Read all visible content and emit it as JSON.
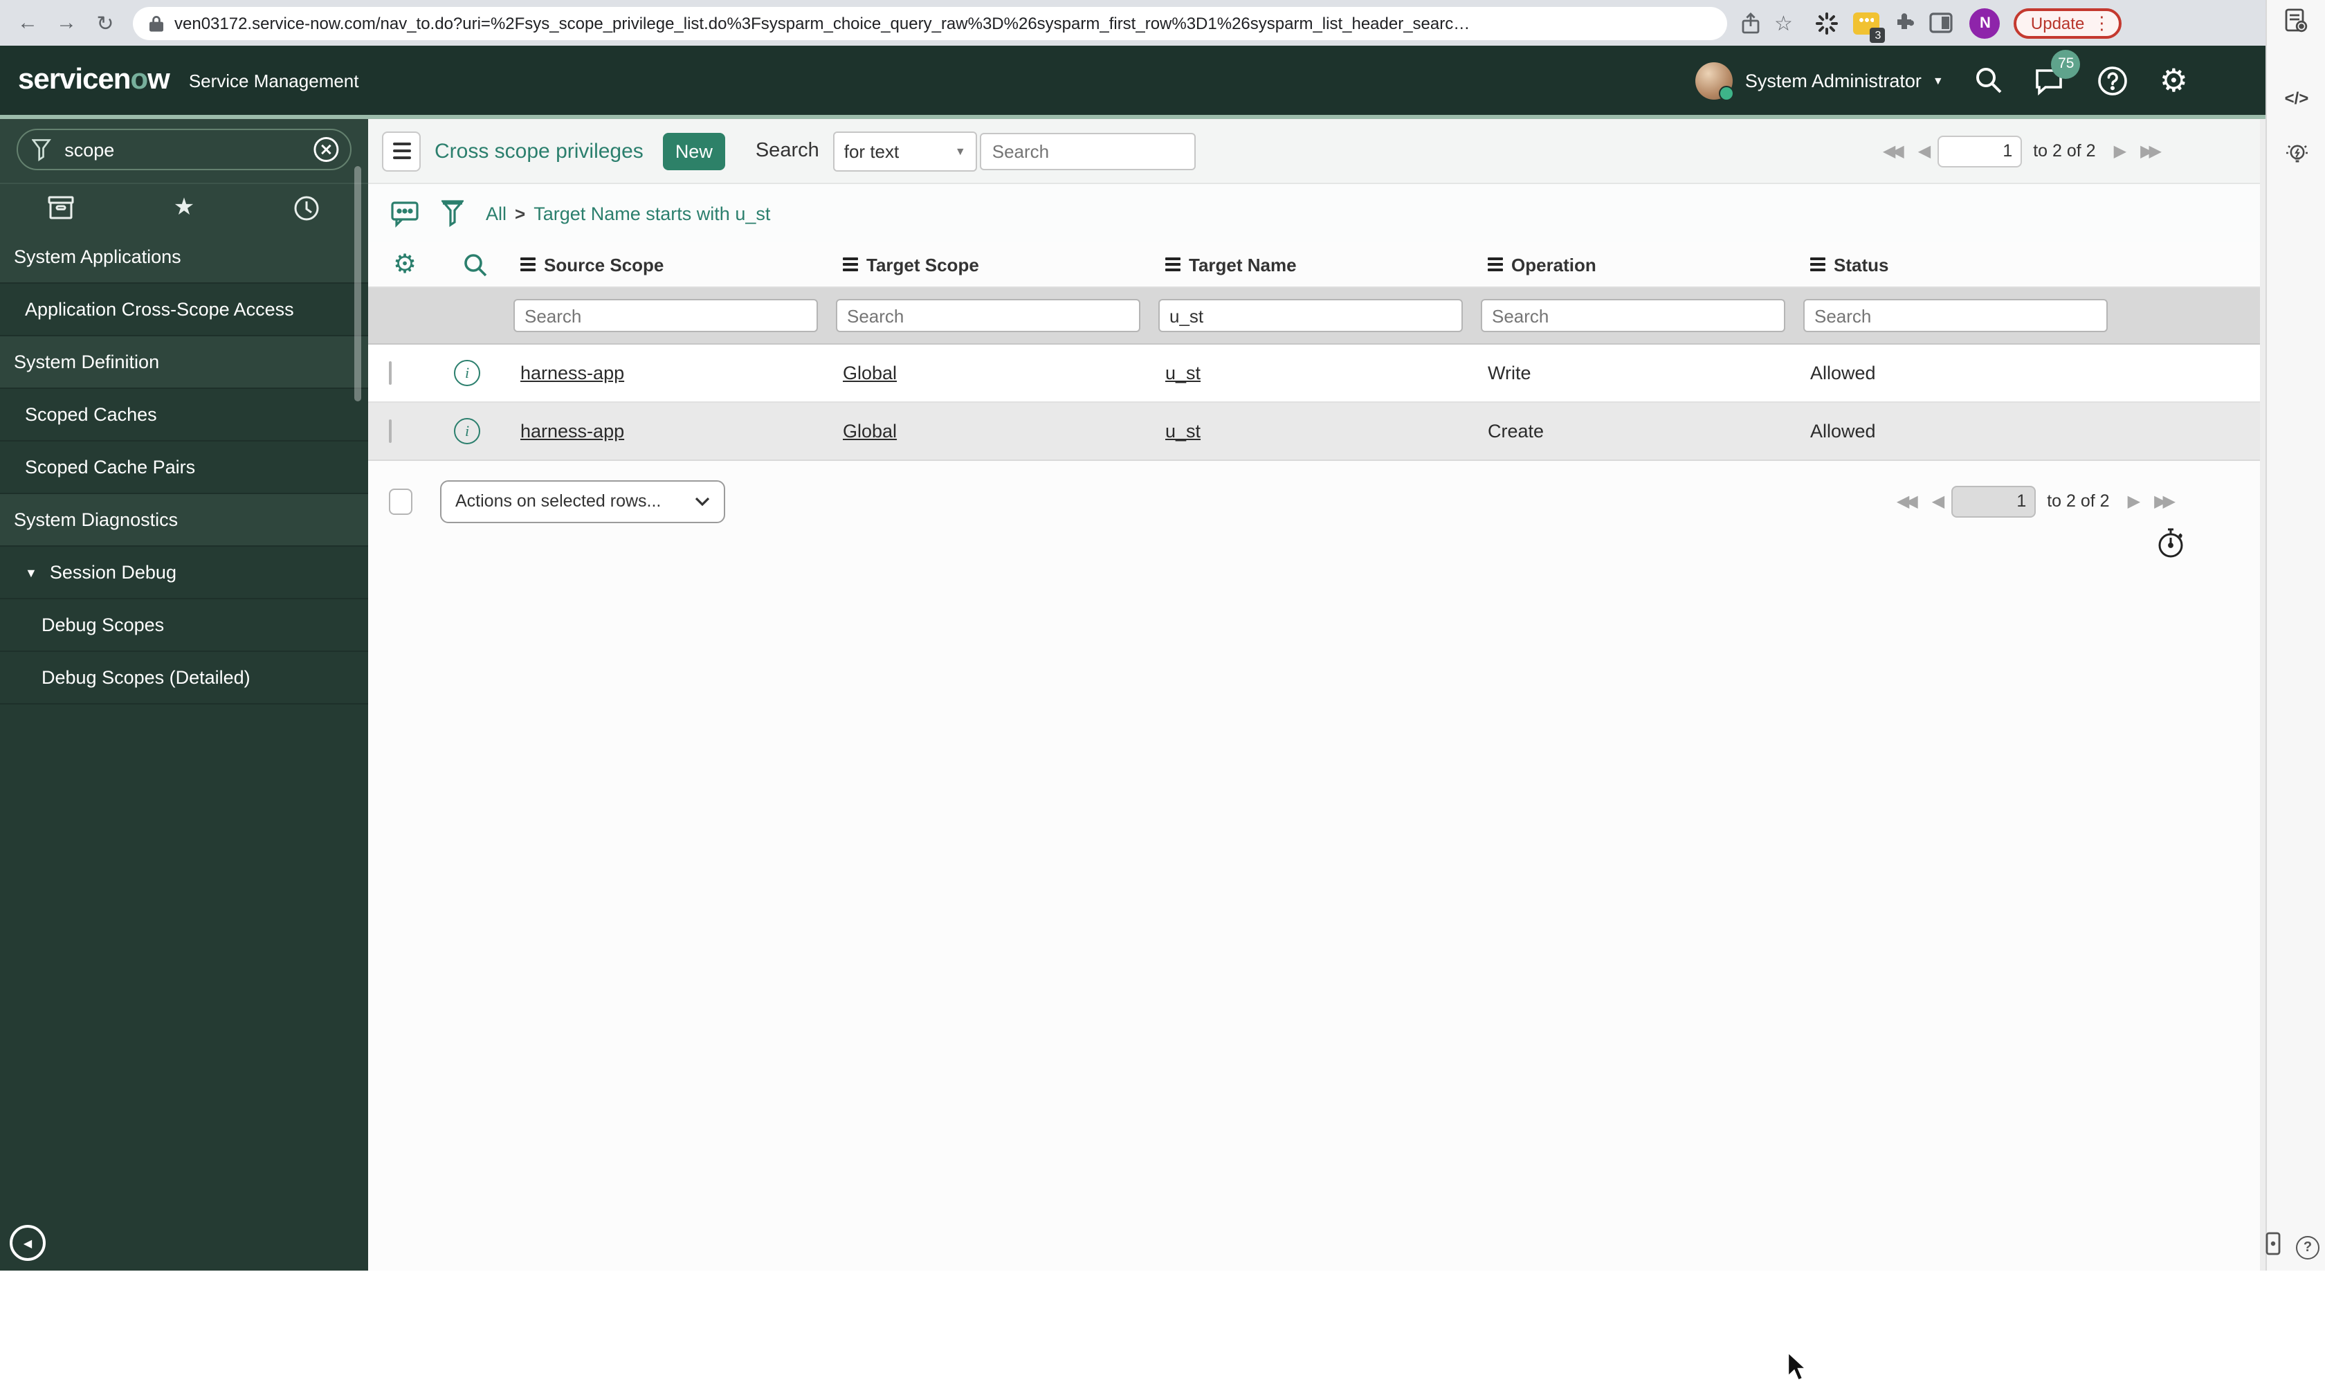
{
  "browser": {
    "url": "ven03172.service-now.com/nav_to.do?uri=%2Fsys_scope_privilege_list.do%3Fsysparm_choice_query_raw%3D%26sysparm_first_row%3D1%26sysparm_list_header_searc…",
    "update_label": "Update",
    "extension_badge": "3",
    "profile_initial": "N"
  },
  "icons": {
    "back": "←",
    "forward": "→",
    "reload": "↻",
    "bookmark_star": "☆",
    "dots_vertical": "⋮",
    "user_caret": "▼",
    "select_caret": "▼",
    "gear": "⚙",
    "help": "?",
    "code_panel": "</>",
    "pager_first": "◀◀",
    "pager_prev": "◀",
    "pager_next": "▶",
    "pager_last": "▶▶",
    "favorites_star": "★",
    "expand_caret": "▼",
    "collapse_back": "◀",
    "info": "i"
  },
  "header": {
    "logo_pre": "servicen",
    "logo_o": "o",
    "logo_post": "w",
    "product": "Service Management",
    "user_name": "System Administrator",
    "notifications_count": "75"
  },
  "sidebar": {
    "search_value": "scope",
    "items": [
      {
        "label": "System Applications",
        "type": "header"
      },
      {
        "label": "Application Cross-Scope Access",
        "type": "item"
      },
      {
        "label": "System Definition",
        "type": "header"
      },
      {
        "label": "Scoped Caches",
        "type": "item"
      },
      {
        "label": "Scoped Cache Pairs",
        "type": "item"
      },
      {
        "label": "System Diagnostics",
        "type": "header"
      },
      {
        "label": "Session Debug",
        "type": "expandable"
      },
      {
        "label": "Debug Scopes",
        "type": "subitem"
      },
      {
        "label": "Debug Scopes (Detailed)",
        "type": "subitem"
      }
    ]
  },
  "toolbar": {
    "title": "Cross scope privileges",
    "new_label": "New",
    "search_label": "Search",
    "search_mode": "for text",
    "search_placeholder": "Search"
  },
  "breadcrumb": {
    "root": "All",
    "separator": ">",
    "filter": "Target Name starts with u_st"
  },
  "table": {
    "columns": [
      "Source Scope",
      "Target Scope",
      "Target Name",
      "Operation",
      "Status"
    ],
    "filter_placeholder": "Search",
    "target_name_filter": "u_st",
    "rows": [
      {
        "source_scope": "harness-app",
        "target_scope": "Global",
        "target_name": "u_st",
        "operation": "Write",
        "status": "Allowed"
      },
      {
        "source_scope": "harness-app",
        "target_scope": "Global",
        "target_name": "u_st",
        "operation": "Create",
        "status": "Allowed"
      }
    ]
  },
  "pagination": {
    "page": "1",
    "range_label": "to 2 of 2"
  },
  "actions_bar": {
    "dropdown_label": "Actions on selected rows..."
  },
  "colors": {
    "accent": "#2d8168",
    "header_bg": "#1d332c",
    "sidebar_bg": "#253b33",
    "sidebar_row_alt": "#2f463d",
    "badge": "#5fa38c",
    "update_red": "#c4392f",
    "avatar_purple": "#8e24aa",
    "extension_yellow": "#f1c232",
    "sage_line": "#9cbcab"
  }
}
